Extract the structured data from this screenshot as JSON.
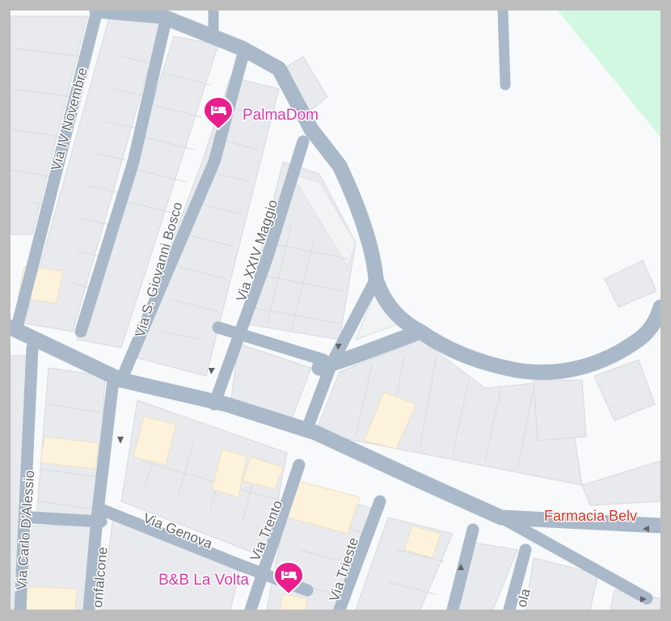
{
  "map": {
    "colors": {
      "road": "#aab9c9",
      "block": "#e8eaed",
      "building_highlight": "#fdf3dc",
      "park": "#d3f8e2",
      "background": "#f8f9fa",
      "poi_pink": "#e91e8c",
      "pharmacy_red": "#d93025"
    },
    "streets": {
      "via_iv_novembre": "Via IV Novembre",
      "via_s_giovanni_bosco": "Via S. Giovanni Bosco",
      "via_xxiv_maggio": "Via XXIV Maggio",
      "via_carlo_dalessio": "Via Carlo D'Alessio",
      "confalcone": "onfalcone",
      "via_genova": "Via Genova",
      "via_trento": "Via Trento",
      "via_trieste": "Via Trieste",
      "ola": "ola"
    },
    "pois": {
      "palmadom": {
        "label": "PalmaDom",
        "icon": "bed-icon"
      },
      "bb_la_volta": {
        "label": "B&B La Volta",
        "icon": "bed-icon"
      },
      "farmacia": {
        "label": "Farmacia Belv"
      }
    }
  }
}
